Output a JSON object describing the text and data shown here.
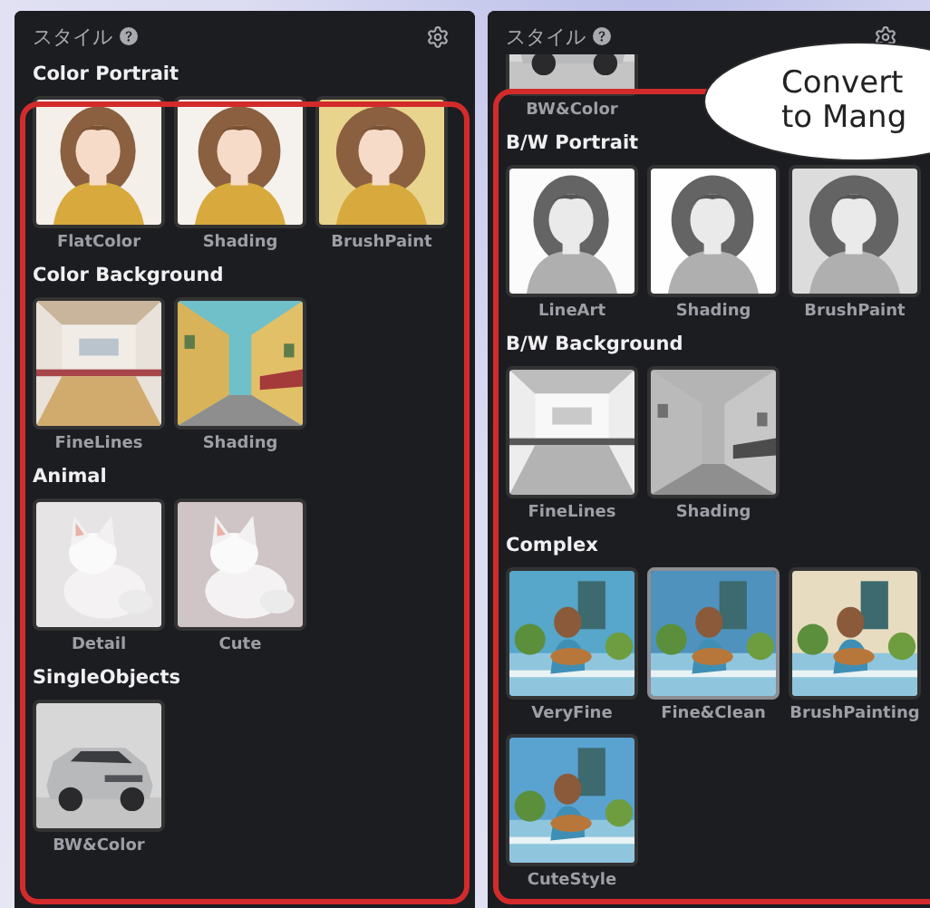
{
  "panels": [
    {
      "title": "スタイル",
      "scrolled": false,
      "sections": [
        {
          "heading": "Color Portrait",
          "items": [
            {
              "label": "FlatColor",
              "selected": false
            },
            {
              "label": "Shading",
              "selected": false
            },
            {
              "label": "BrushPaint",
              "selected": false
            }
          ]
        },
        {
          "heading": "Color Background",
          "items": [
            {
              "label": "FineLines",
              "selected": false
            },
            {
              "label": "Shading",
              "selected": false
            }
          ]
        },
        {
          "heading": "Animal",
          "items": [
            {
              "label": "Detail",
              "selected": false
            },
            {
              "label": "Cute",
              "selected": false
            }
          ]
        },
        {
          "heading": "SingleObjects",
          "items": [
            {
              "label": "BW&Color",
              "selected": false
            }
          ]
        }
      ]
    },
    {
      "title": "スタイル",
      "scrolled": true,
      "sections": [
        {
          "items": [
            {
              "label": "BW&Color",
              "selected": false
            }
          ]
        },
        {
          "heading": "B/W Portrait",
          "items": [
            {
              "label": "LineArt",
              "selected": false
            },
            {
              "label": "Shading",
              "selected": false
            },
            {
              "label": "BrushPaint",
              "selected": false
            }
          ]
        },
        {
          "heading": "B/W Background",
          "items": [
            {
              "label": "FineLines",
              "selected": false
            },
            {
              "label": "Shading",
              "selected": false
            }
          ]
        },
        {
          "heading": "Complex",
          "items": [
            {
              "label": "VeryFine",
              "selected": false
            },
            {
              "label": "Fine&Clean",
              "selected": true
            },
            {
              "label": "BrushPainting",
              "selected": false
            },
            {
              "label": "CuteStyle",
              "selected": false
            }
          ]
        }
      ]
    }
  ],
  "callout": {
    "lines": [
      "Convert",
      "to Mang"
    ]
  }
}
